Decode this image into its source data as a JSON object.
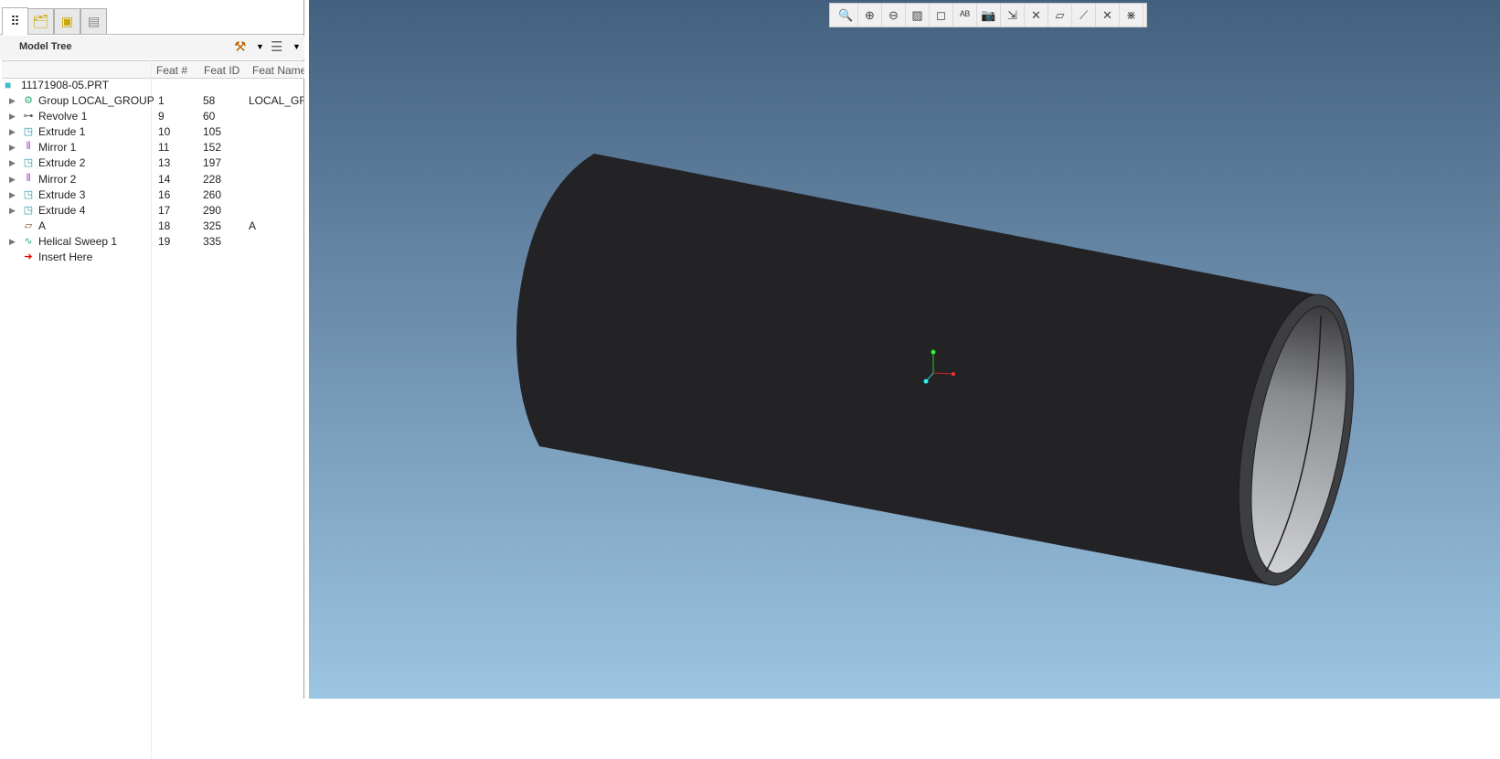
{
  "tabs": [
    {
      "icon": "model-tree-icon"
    },
    {
      "icon": "layers-icon"
    },
    {
      "icon": "folder-browser-icon"
    },
    {
      "icon": "favorites-search-icon"
    }
  ],
  "model_tree": {
    "title": "Model Tree",
    "settings_icon": "tree-settings-icon",
    "show_icon": "tree-columns-icon"
  },
  "columns": [
    "Feat #",
    "Feat ID",
    "Feat Name"
  ],
  "root": "11171908-05.PRT",
  "rows": [
    {
      "name": "Group LOCAL_GROUP",
      "num": "1",
      "id": "58",
      "fname": "LOCAL_GROUP",
      "icon": "group-icon",
      "expandable": true
    },
    {
      "name": "Revolve 1",
      "num": "9",
      "id": "60",
      "fname": "",
      "icon": "revolve-icon",
      "expandable": true
    },
    {
      "name": "Extrude 1",
      "num": "10",
      "id": "105",
      "fname": "",
      "icon": "extrude-icon",
      "expandable": true
    },
    {
      "name": "Mirror 1",
      "num": "11",
      "id": "152",
      "fname": "",
      "icon": "mirror-icon",
      "expandable": true
    },
    {
      "name": "Extrude 2",
      "num": "13",
      "id": "197",
      "fname": "",
      "icon": "extrude-icon",
      "expandable": true
    },
    {
      "name": "Mirror 2",
      "num": "14",
      "id": "228",
      "fname": "",
      "icon": "mirror-icon",
      "expandable": true
    },
    {
      "name": "Extrude 3",
      "num": "16",
      "id": "260",
      "fname": "",
      "icon": "extrude-icon",
      "expandable": true
    },
    {
      "name": "Extrude 4",
      "num": "17",
      "id": "290",
      "fname": "",
      "icon": "extrude-icon",
      "expandable": true
    },
    {
      "name": "A",
      "num": "18",
      "id": "325",
      "fname": "A",
      "icon": "datum-plane-icon",
      "expandable": false
    },
    {
      "name": "Helical Sweep 1",
      "num": "19",
      "id": "335",
      "fname": "",
      "icon": "helical-sweep-icon",
      "expandable": true
    },
    {
      "name": "Insert Here",
      "num": "",
      "id": "",
      "fname": "",
      "icon": "insert-arrow-icon",
      "expandable": false
    }
  ],
  "toolbar": [
    "refit-icon",
    "zoom-in-icon",
    "zoom-out-icon",
    "repaint-icon",
    "display-style-icon",
    "saved-views-icon",
    "view-manager-icon",
    "orient-icon",
    "datum-axis-display-icon",
    "datum-plane-display-icon",
    "datum-point-display-icon",
    "coord-sys-display-icon",
    "annotation-display-icon"
  ],
  "colors": {
    "viewport_top": "#44607f",
    "viewport_bottom": "#9cc5e2",
    "part": "#232326"
  }
}
